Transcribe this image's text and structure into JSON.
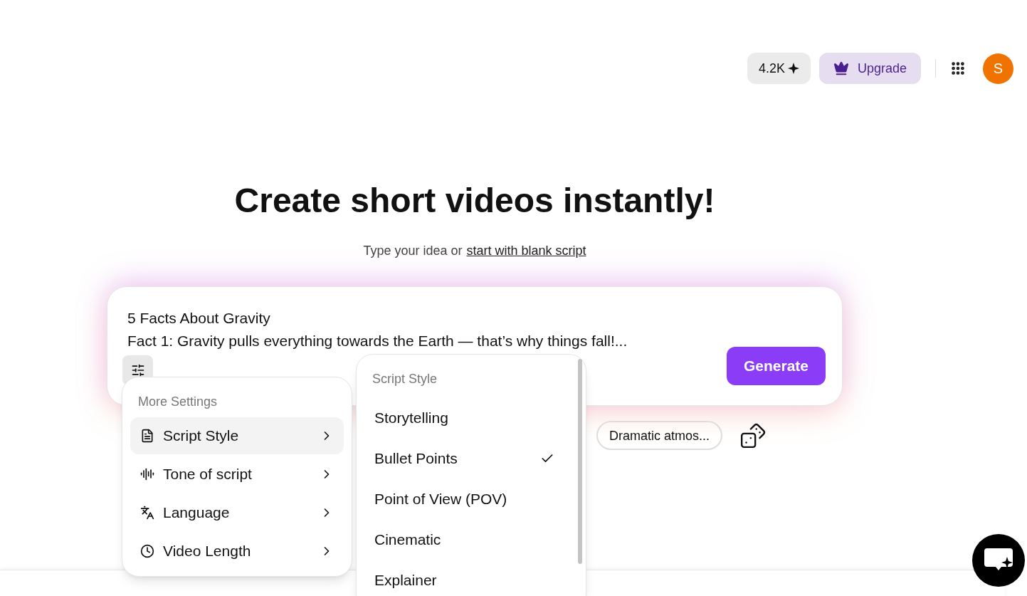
{
  "header": {
    "credits": "4.2K",
    "upgrade": "Upgrade",
    "avatar": "S"
  },
  "hero": {
    "title": "Create short videos instantly!",
    "subtitle_prefix": "Type your idea or",
    "subtitle_link": "start with blank script"
  },
  "prompt": {
    "value": "5 Facts About Gravity\nFact 1: Gravity pulls everything towards the Earth — that’s why things fall!...",
    "generate": "Generate"
  },
  "chips": [
    "Dramatic atmos..."
  ],
  "settings_menu": {
    "title": "More Settings",
    "items": [
      {
        "kind": "script",
        "label": "Script Style",
        "selected": true
      },
      {
        "kind": "tone",
        "label": "Tone of script",
        "selected": false
      },
      {
        "kind": "language",
        "label": "Language",
        "selected": false
      },
      {
        "kind": "length",
        "label": "Video Length",
        "selected": false
      }
    ]
  },
  "style_menu": {
    "title": "Script Style",
    "options": [
      {
        "label": "Storytelling",
        "selected": false
      },
      {
        "label": "Bullet Points",
        "selected": true
      },
      {
        "label": "Point of View (POV)",
        "selected": false
      },
      {
        "label": "Cinematic",
        "selected": false
      },
      {
        "label": "Explainer",
        "selected": false
      }
    ]
  }
}
